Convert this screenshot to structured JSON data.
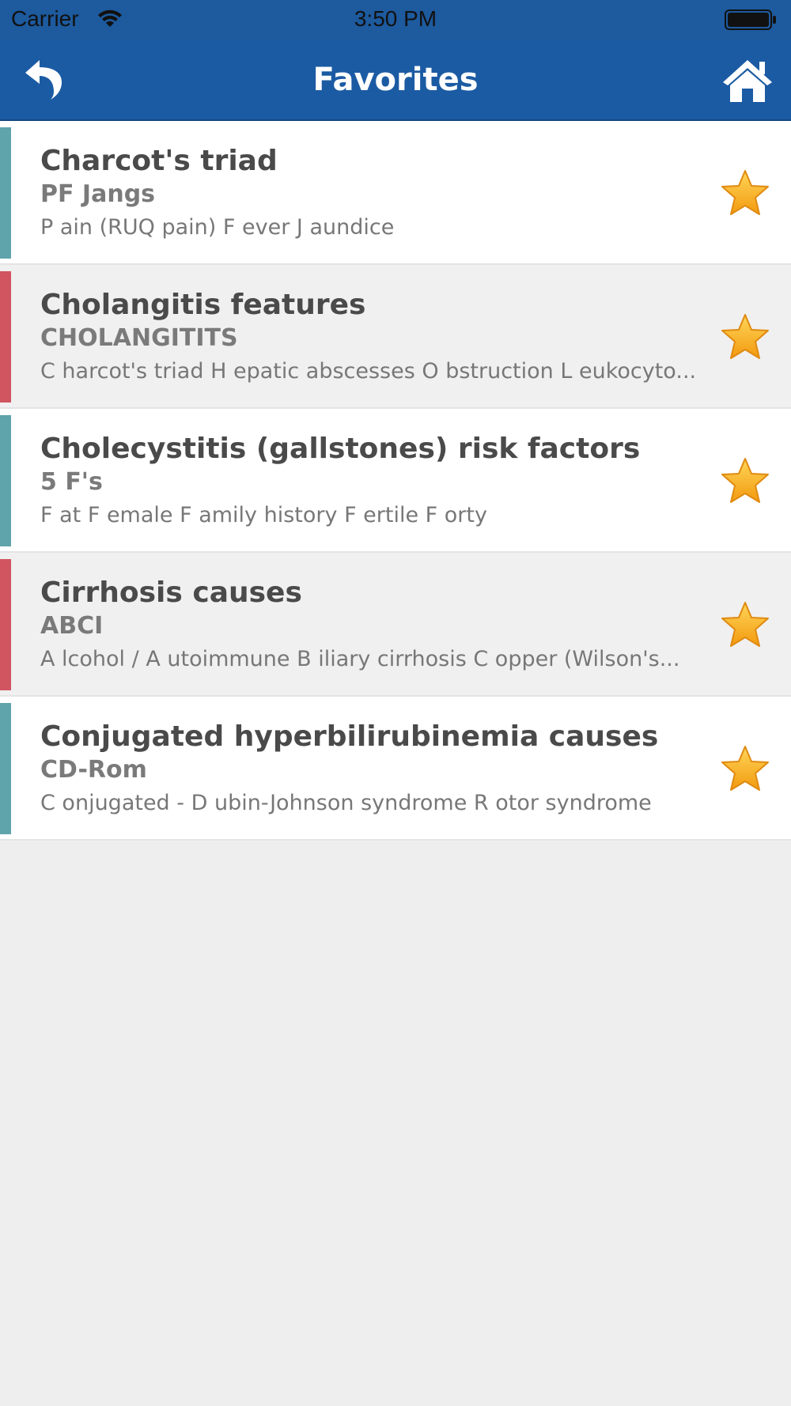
{
  "status": {
    "carrier": "Carrier",
    "time": "3:50 PM"
  },
  "nav": {
    "title": "Favorites",
    "back_icon": "back-arrow-icon",
    "home_icon": "home-icon"
  },
  "colors": {
    "nav_bg": "#1b5ba3",
    "teal": "#5fa3ab",
    "red": "#d05560",
    "star": "#f7b824"
  },
  "items": [
    {
      "title": "Charcot's triad",
      "mnemonic": "PF Jangs",
      "description": "P ain (RUQ pain) F ever J aundice",
      "stripe": "teal"
    },
    {
      "title": "Cholangitis features",
      "mnemonic": "CHOLANGITITS",
      "description": "C harcot's triad H epatic abscesses O bstruction L eukocyto...",
      "stripe": "red"
    },
    {
      "title": "Cholecystitis (gallstones) risk factors",
      "mnemonic": "5 F's",
      "description": "F at F emale F amily history F ertile F orty",
      "stripe": "teal"
    },
    {
      "title": "Cirrhosis causes",
      "mnemonic": "ABCI",
      "description": "A lcohol / A utoimmune B iliary cirrhosis C opper (Wilson's...",
      "stripe": "red"
    },
    {
      "title": "Conjugated hyperbilirubinemia causes",
      "mnemonic": "CD-Rom",
      "description": "C onjugated - D ubin-Johnson syndrome R otor syndrome",
      "stripe": "teal"
    }
  ]
}
